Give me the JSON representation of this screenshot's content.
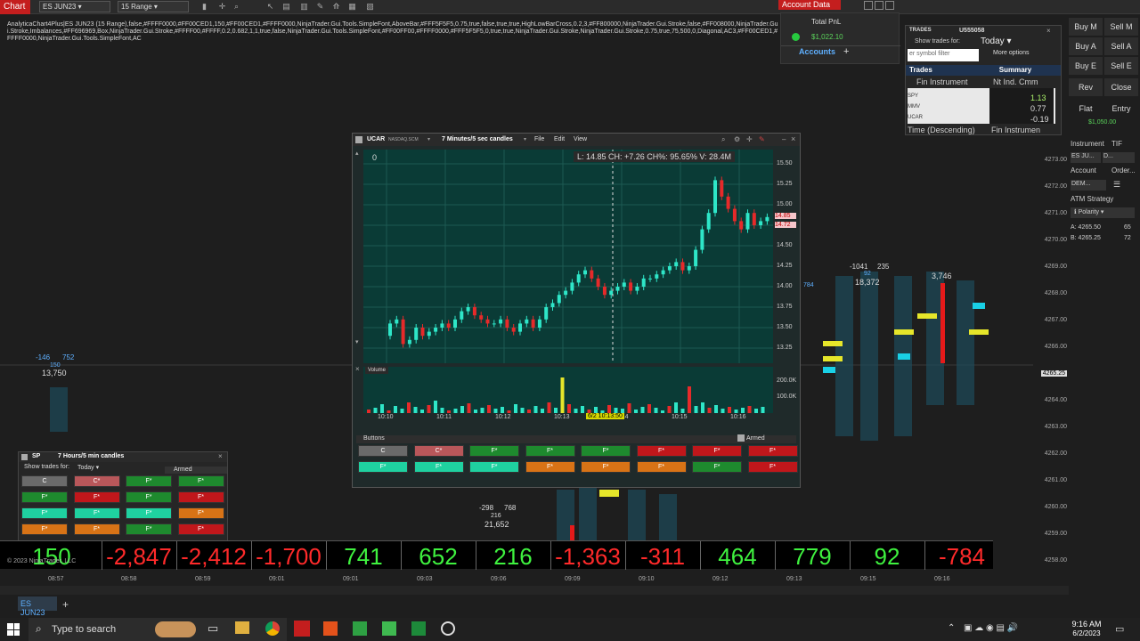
{
  "topbar": {
    "chart_tab": "Chart",
    "instrument": "ES JUN23",
    "range": "15 Range",
    "account_data": "Account Data"
  },
  "params": "AnalyticaChart4Plus|ES JUN23 (15 Range),false,#FFFF0000,#FF00CED1,150,#FF00CED1,#FFFF0000,NinjaTrader.Gui.Tools.SimpleFont,AboveBar,#FFF5F5F5,0.75,true,false,true,true,HighLowBarCross,0.2,3,#FF800000,NinjaTrader.Gui.Stroke,false,#FF008000,NinjaTrader.Gui.Stroke,Imbalances,#FF696969,Box,NinjaTrader.Gui.Stroke,#FFFF00,#FFFF,0.2,0.682,1,1,true,false,NinjaTrader.Gui.Tools.SimpleFont,#FF00FF00,#FFFF0000,#FFF5F5F5,0,true,true,NinjaTrader.Gui.Stroke,NinjaTrader.Gui.Stroke,0.75,true,75,500,0,Diagonal,AC3,#FF00CED1,#FFFF0000,NinjaTrader.Gui.Tools.SimpleFont,AC",
  "account": {
    "header": "Total PnL",
    "pnl": "$1,022.10",
    "tab": "Accounts",
    "add": "+"
  },
  "trades": {
    "title": "TRADES",
    "account": "U555058",
    "show_for": "Show trades for:",
    "period": "Today",
    "filter_placeholder": "er symbol filter",
    "more": "More options",
    "tab_trades": "Trades",
    "tab_summary": "Summary",
    "col1": "Fin Instrument",
    "col2": "Nt Ind. Cmm",
    "rows": [
      {
        "sym": "SPY",
        "val": "1.13"
      },
      {
        "sym": "MMV",
        "val": "0.77"
      },
      {
        "sym": "UCAR",
        "val": "-0.19"
      }
    ],
    "footer1": "Time (Descending)",
    "footer2": "Fin Instrumen"
  },
  "right": {
    "buy_m": "Buy M",
    "sell_m": "Sell M",
    "buy_a": "Buy A",
    "sell_a": "Sell A",
    "buy_e": "Buy E",
    "sell_e": "Sell E",
    "rev": "Rev",
    "close": "Close",
    "flat": "Flat",
    "entry": "Entry",
    "balance": "$1,050.00",
    "instrument": "Instrument",
    "tif": "TIF",
    "instrument_val": "ES JU...",
    "d": "D...",
    "account": "Account",
    "order": "Order...",
    "demo": "DEM...",
    "atm": "ATM Strategy",
    "atm_val": "Polarity",
    "ask": "A: 4265.50",
    "ask_n": "65",
    "bid": "B: 4265.25",
    "bid_n": "72"
  },
  "price_axis": [
    "4273.00",
    "4272.00",
    "4271.00",
    "4270.00",
    "4269.00",
    "4268.00",
    "4267.00",
    "4266.00",
    "4265.25",
    "4264.00",
    "4263.00",
    "4262.00",
    "4261.00",
    "4260.00",
    "4259.00",
    "4258.00"
  ],
  "ucar": {
    "symbol": "UCAR",
    "exchange": "NASDAQ.SCM",
    "interval": "7 Minutes/5 sec candles",
    "file": "File",
    "edit": "Edit",
    "view": "View",
    "zero": "0",
    "info": "L: 14.85 CH: +7.26 CH%: 95.65% V: 28.4M",
    "volume": "Volume",
    "crosshair_time": "6/2 10:13:50",
    "vol_200": "200.0K",
    "vol_100": "100.0K",
    "price_tag1": "14.85",
    "price_tag2": "14.72",
    "side": "784",
    "price_ticks": [
      "15.50",
      "15.25",
      "15.00",
      "14.75",
      "14.50",
      "14.25",
      "14.00",
      "13.75",
      "13.50",
      "13.25"
    ],
    "time_ticks": [
      "10:10",
      "10:11",
      "10:12",
      "10:13",
      "10:14",
      "10:15",
      "10:16"
    ],
    "buttons_label": "Buttons",
    "armed": "Armed"
  },
  "sp": {
    "symbol": "SP",
    "interval": "7 Hours/5 min candles",
    "show_for": "Show trades for:",
    "period": "Today",
    "armed": "Armed"
  },
  "ticker": [
    "150",
    "-2,847",
    "-2,412",
    "-1,700",
    "741",
    "652",
    "216",
    "-1,363",
    "-311",
    "464",
    "779",
    "92",
    "-784"
  ],
  "chart_labels": {
    "l1": "-146",
    "l2": "752",
    "l3": "150",
    "l4": "13,750",
    "m1": "-1041",
    "m2": "235",
    "m3": "92",
    "m4": "18,372",
    "m5": "3,746",
    "b1": "-298",
    "b2": "768",
    "b3": "216",
    "b4": "21,652",
    "copyright": "© 2023 NinjaTrader, LLC"
  },
  "time_axis": [
    "08:57",
    "08:58",
    "08:59",
    "09:01",
    "09:01",
    "09:03",
    "09:06",
    "09:09",
    "09:10",
    "09:12",
    "09:13",
    "09:15",
    "09:16"
  ],
  "bottom_tab": "ES JUN23",
  "taskbar": {
    "search": "Type to search",
    "time": "9:16 AM",
    "date": "6/2/2023"
  }
}
